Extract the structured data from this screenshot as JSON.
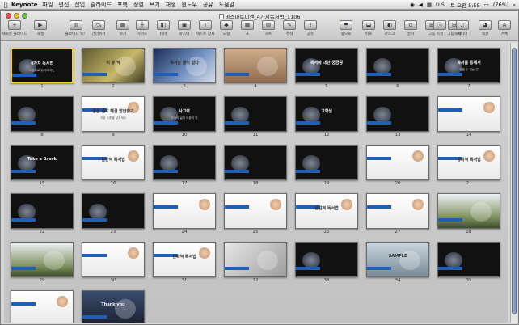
{
  "menubar": {
    "app": "Keynote",
    "items": [
      "파일",
      "편집",
      "삽입",
      "슬라이드",
      "포맷",
      "정렬",
      "보기",
      "재생",
      "윈도우",
      "공유",
      "도움말"
    ],
    "locale": "U.S.",
    "clock": "토 오전 5:55",
    "battery": "(76%)"
  },
  "window": {
    "title": "바스마트니엔_4가지독서법_1106"
  },
  "toolbar": {
    "items": [
      {
        "label": "새로운 슬라이드",
        "icon": "plus-icon"
      },
      {
        "label": "재생",
        "icon": "play-icon"
      },
      {
        "label": "슬라이드 보기",
        "icon": "view-icon"
      },
      {
        "label": "건너뛰기",
        "icon": "skip-icon"
      },
      {
        "label": "보기",
        "icon": "view-menu-icon"
      },
      {
        "label": "가이드",
        "icon": "guides-icon"
      },
      {
        "label": "테마",
        "icon": "theme-icon"
      },
      {
        "label": "마스터",
        "icon": "master-icon"
      },
      {
        "label": "텍스트 상자",
        "icon": "textbox-icon"
      },
      {
        "label": "도형",
        "icon": "shapes-icon"
      },
      {
        "label": "표",
        "icon": "table-icon"
      },
      {
        "label": "차트",
        "icon": "chart-icon"
      },
      {
        "label": "주석",
        "icon": "comment-icon"
      },
      {
        "label": "공유",
        "icon": "share-icon"
      },
      {
        "label": "앞으로",
        "icon": "front-icon"
      },
      {
        "label": "뒤로",
        "icon": "back-icon"
      },
      {
        "label": "마스크",
        "icon": "mask-icon"
      },
      {
        "label": "알파",
        "icon": "alpha-icon"
      },
      {
        "label": "그룹",
        "icon": "group-icon"
      },
      {
        "label": "그룹해제",
        "icon": "ungroup-icon"
      },
      {
        "label": "속성",
        "icon": "inspector-icon"
      },
      {
        "label": "미디어",
        "icon": "media-icon"
      },
      {
        "label": "색상",
        "icon": "colors-icon"
      },
      {
        "label": "서체",
        "icon": "fonts-icon"
      }
    ]
  },
  "slides": [
    {
      "n": "1",
      "style": "dk",
      "t1": "4가지 독서법",
      "t2": "느낌으로 읽어야 하는"
    },
    {
      "n": "2",
      "style": "photo-olive",
      "t1": "이 유 익",
      "t2": ""
    },
    {
      "n": "3",
      "style": "photo-blue",
      "t1": "독서는 끝이 없다",
      "t2": ""
    },
    {
      "n": "4",
      "style": "photo-feet",
      "t1": "",
      "t2": ""
    },
    {
      "n": "5",
      "style": "dk",
      "t1": "독서에 대한 궁금증",
      "t2": ""
    },
    {
      "n": "6",
      "style": "dk",
      "t1": "",
      "t2": ""
    },
    {
      "n": "7",
      "style": "dk",
      "t1": "독서를 통해서",
      "t2": "얻을 수 있는 것"
    },
    {
      "n": "8",
      "style": "dk",
      "t1": "",
      "t2": ""
    },
    {
      "n": "9",
      "style": "wh",
      "t1": "좋은 생각 해결 방안찾기",
      "t2": "가공 수준을 낮추세요"
    },
    {
      "n": "10",
      "style": "dk",
      "t1": "사고력",
      "t2": "자식의 넓이  이중의 힘"
    },
    {
      "n": "11",
      "style": "dk",
      "t1": "",
      "t2": ""
    },
    {
      "n": "12",
      "style": "dk",
      "t1": "고학생",
      "t2": ""
    },
    {
      "n": "13",
      "style": "dk",
      "t1": "",
      "t2": ""
    },
    {
      "n": "14",
      "style": "wh",
      "t1": "",
      "t2": ""
    },
    {
      "n": "15",
      "style": "dk",
      "t1": "Take a Break",
      "t2": ""
    },
    {
      "n": "16",
      "style": "wh",
      "t1": "일반적 독서법",
      "t2": ""
    },
    {
      "n": "17",
      "style": "dk",
      "t1": "",
      "t2": ""
    },
    {
      "n": "18",
      "style": "dk",
      "t1": "",
      "t2": ""
    },
    {
      "n": "19",
      "style": "dk",
      "t1": "",
      "t2": ""
    },
    {
      "n": "20",
      "style": "wh",
      "t1": "",
      "t2": ""
    },
    {
      "n": "21",
      "style": "wh",
      "t1": "창의적 독서법",
      "t2": ""
    },
    {
      "n": "22",
      "style": "dk",
      "t1": "",
      "t2": ""
    },
    {
      "n": "23",
      "style": "dk",
      "t1": "",
      "t2": ""
    },
    {
      "n": "24",
      "style": "wh",
      "t1": "",
      "t2": ""
    },
    {
      "n": "25",
      "style": "wh",
      "t1": "",
      "t2": ""
    },
    {
      "n": "26",
      "style": "wh",
      "t1": "공감적 독서법",
      "t2": ""
    },
    {
      "n": "27",
      "style": "wh",
      "t1": "",
      "t2": ""
    },
    {
      "n": "28",
      "style": "photo-tree",
      "t1": "",
      "t2": ""
    },
    {
      "n": "29",
      "style": "photo-tree",
      "t1": "",
      "t2": ""
    },
    {
      "n": "30",
      "style": "wh",
      "t1": "",
      "t2": ""
    },
    {
      "n": "31",
      "style": "wh",
      "t1": "전략적 독서법",
      "t2": ""
    },
    {
      "n": "32",
      "style": "photo-book",
      "t1": "",
      "t2": ""
    },
    {
      "n": "33",
      "style": "dk",
      "t1": "",
      "t2": ""
    },
    {
      "n": "34",
      "style": "photo-sample",
      "t1": "SAMPLE",
      "t2": ""
    },
    {
      "n": "35",
      "style": "dk",
      "t1": "",
      "t2": ""
    },
    {
      "n": "36",
      "style": "wh",
      "t1": "",
      "t2": ""
    },
    {
      "n": "37",
      "style": "photo-night",
      "t1": "Thank you",
      "t2": ""
    }
  ],
  "colors": {
    "accent_blue": "#1f5fb8",
    "selection": "#f0d234",
    "dark_slide": "#111111"
  }
}
